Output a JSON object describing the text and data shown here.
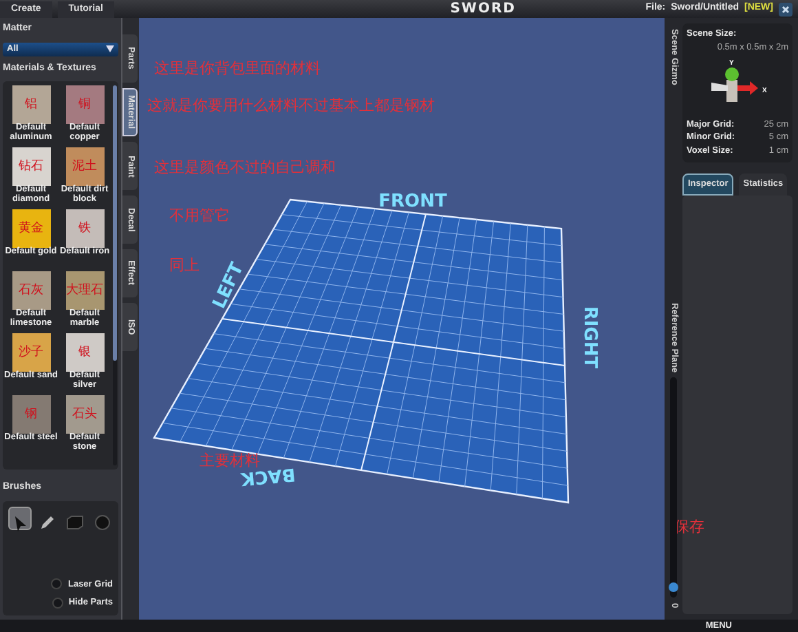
{
  "top_bar": {
    "menu": [
      {
        "label": "Create"
      },
      {
        "label": "Tutorial"
      }
    ],
    "title": "SWORD",
    "file_label": "File:",
    "file_name": "Sword/Untitled",
    "file_tag": "[NEW]"
  },
  "left_panel": {
    "matter_title": "Matter",
    "filter": "All",
    "materials_title": "Materials & Textures",
    "materials": [
      {
        "name": "Default aluminum",
        "note": "铝",
        "color": "#b3a696"
      },
      {
        "name": "Default copper",
        "note": "铜",
        "color": "#a47a80"
      },
      {
        "name": "Default diamond",
        "note": "钻石",
        "color": "#d8d4cf"
      },
      {
        "name": "Default dirt block",
        "note": "泥土",
        "color": "#c08c5c"
      },
      {
        "name": "Default gold",
        "note": "黄金",
        "color": "#e8b410"
      },
      {
        "name": "Default iron",
        "note": "铁",
        "color": "#c4bcb8"
      },
      {
        "name": "Default limestone",
        "note": "石灰",
        "color": "#a89a86"
      },
      {
        "name": "Default marble",
        "note": "大理石",
        "color": "#a89670"
      },
      {
        "name": "Default sand",
        "note": "沙子",
        "color": "#d8a448"
      },
      {
        "name": "Default silver",
        "note": "银",
        "color": "#cfcac6"
      },
      {
        "name": "Default steel",
        "note": "钢",
        "color": "#847a72"
      },
      {
        "name": "Default stone",
        "note": "石头",
        "color": "#a29a8e"
      }
    ],
    "brushes_title": "Brushes",
    "brushes": [
      {
        "kind": "select",
        "selected": true
      },
      {
        "kind": "pencil",
        "selected": false
      },
      {
        "kind": "cube",
        "selected": false
      },
      {
        "kind": "sphere",
        "selected": false
      }
    ],
    "options": [
      {
        "label": "Laser Grid",
        "checked": false
      },
      {
        "label": "Hide Parts",
        "checked": false
      }
    ]
  },
  "side_tabs": [
    {
      "label": "Parts",
      "selected": false
    },
    {
      "label": "Material",
      "selected": true
    },
    {
      "label": "Paint",
      "selected": false
    },
    {
      "label": "Decal",
      "selected": false
    },
    {
      "label": "Effect",
      "selected": false
    },
    {
      "label": "ISO",
      "selected": false
    }
  ],
  "viewport": {
    "labels": {
      "front": "FRONT",
      "left": "LEFT",
      "right": "RIGHT",
      "back": "BACK"
    },
    "annotations": [
      {
        "text": "这里是你背包里面的材料"
      },
      {
        "text": "这就是你要用什么材料不过基本上都是钢材"
      },
      {
        "text": "这里是颜色不过的自己调和"
      },
      {
        "text": "不用管它"
      },
      {
        "text": "同上"
      },
      {
        "text": "主要材料"
      },
      {
        "text": "保存"
      }
    ]
  },
  "scene_gizmo": {
    "tab": "Scene Gizmo",
    "size_label": "Scene Size:",
    "size_value": "0.5m x 0.5m x 2m",
    "axes": [
      "Y",
      "X"
    ],
    "stats": [
      {
        "label": "Major Grid:",
        "value": "25 cm"
      },
      {
        "label": "Minor Grid:",
        "value": "5 cm"
      },
      {
        "label": "Voxel Size:",
        "value": "1 cm"
      }
    ]
  },
  "inspector_tabs": [
    {
      "label": "Inspector",
      "selected": true
    },
    {
      "label": "Statistics",
      "selected": false
    }
  ],
  "reference_plane": {
    "label": "Reference Plane",
    "level": 0.03,
    "reading": "0"
  },
  "bottom_bar": {
    "menu": "MENU"
  }
}
